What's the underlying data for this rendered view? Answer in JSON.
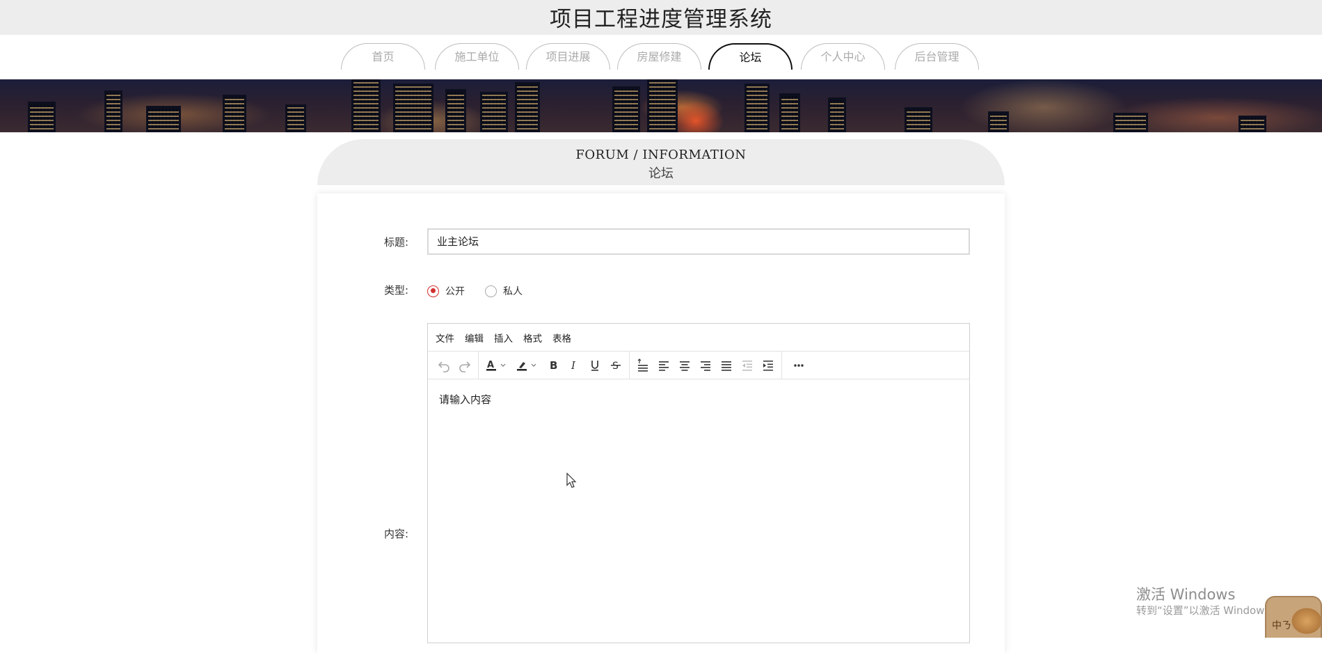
{
  "header": {
    "title": "项目工程进度管理系统"
  },
  "nav": {
    "tabs": [
      {
        "label": "首页",
        "active": false
      },
      {
        "label": "施工单位",
        "active": false
      },
      {
        "label": "项目进展",
        "active": false
      },
      {
        "label": "房屋修建",
        "active": false
      },
      {
        "label": "论坛",
        "active": true
      },
      {
        "label": "个人中心",
        "active": false
      },
      {
        "label": "后台管理",
        "active": false
      }
    ]
  },
  "section": {
    "title_en": "FORUM / INFORMATION",
    "title_cn": "论坛"
  },
  "form": {
    "title_label": "标题:",
    "title_value": "业主论坛",
    "type_label": "类型:",
    "type_options": [
      {
        "label": "公开",
        "checked": true
      },
      {
        "label": "私人",
        "checked": false
      }
    ],
    "content_label": "内容:"
  },
  "editor": {
    "menus": [
      "文件",
      "编辑",
      "插入",
      "格式",
      "表格"
    ],
    "toolbar_icons": [
      "undo-icon",
      "redo-icon",
      "text-color-icon",
      "highlight-color-icon",
      "bold-icon",
      "italic-icon",
      "underline-icon",
      "strikethrough-icon",
      "line-height-icon",
      "align-left-icon",
      "align-center-icon",
      "align-right-icon",
      "align-justify-icon",
      "outdent-icon",
      "indent-icon",
      "more-icon"
    ],
    "placeholder": "请输入内容"
  },
  "watermark": {
    "line1": "激活 Windows",
    "line2": "转到“设置”以激活 Windows。"
  },
  "mascot": {
    "label": "中ㄋ"
  },
  "colors": {
    "radio_checked": "#d32f2f",
    "header_bg": "#ededee",
    "active_tab_border": "#111111"
  }
}
